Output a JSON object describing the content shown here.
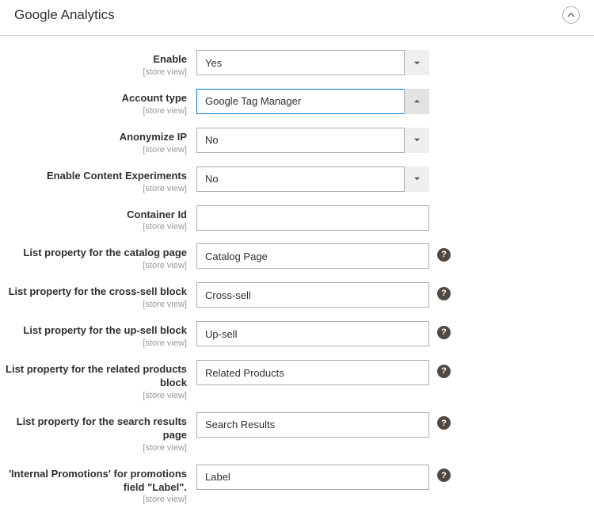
{
  "section_title": "Google Analytics",
  "scope_label": "[store view]",
  "fields": {
    "enable": {
      "label": "Enable",
      "value": "Yes"
    },
    "account_type": {
      "label": "Account type",
      "value": "Google Tag Manager"
    },
    "anonymize_ip": {
      "label": "Anonymize IP",
      "value": "No"
    },
    "enable_experiments": {
      "label": "Enable Content Experiments",
      "value": "No"
    },
    "container_id": {
      "label": "Container Id",
      "value": ""
    },
    "list_catalog": {
      "label": "List property for the catalog page",
      "value": "Catalog Page"
    },
    "list_crosssell": {
      "label": "List property for the cross-sell block",
      "value": "Cross-sell"
    },
    "list_upsell": {
      "label": "List property for the up-sell block",
      "value": "Up-sell"
    },
    "list_related": {
      "label": "List property for the related products block",
      "value": "Related Products"
    },
    "list_search": {
      "label": "List property for the search results page",
      "value": "Search Results"
    },
    "promo_label": {
      "label": "'Internal Promotions' for promotions field \"Label\".",
      "value": "Label"
    }
  }
}
